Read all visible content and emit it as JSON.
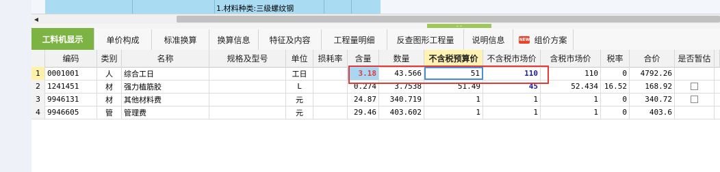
{
  "top_bar": {
    "text": "1.材料种类:三级螺纹钢"
  },
  "tabs": [
    {
      "label": "工料机显示",
      "active": true
    },
    {
      "label": "单价构成"
    },
    {
      "label": "标准换算"
    },
    {
      "label": "换算信息"
    },
    {
      "label": "特征及内容"
    },
    {
      "label": "工程量明细"
    },
    {
      "label": "反查图形工程量"
    },
    {
      "label": "说明信息"
    },
    {
      "label": "组价方案",
      "badge": "NEW"
    }
  ],
  "table": {
    "headers": [
      "编码",
      "类别",
      "名称",
      "规格及型号",
      "单位",
      "损耗率",
      "含量",
      "数量",
      "不含税预算价",
      "不含税市场价",
      "含税市场价",
      "税率",
      "合价",
      "是否暂估"
    ],
    "rows": [
      {
        "num": "1",
        "code": "0001001",
        "type": "人",
        "name": "综合工日",
        "spec": "",
        "unit": "工日",
        "loss": "",
        "content": "3.18",
        "qty": "43.566",
        "budget_price": "51",
        "market_price": "110",
        "tax_market_price": "110",
        "tax_rate": "0",
        "total": "4792.26",
        "checkbox": false
      },
      {
        "num": "2",
        "code": "1241451",
        "type": "材",
        "name": "强力植筋胶",
        "spec": "",
        "unit": "L",
        "loss": "",
        "content": "0.274",
        "qty": "3.7538",
        "budget_price": "51.49",
        "market_price": "45",
        "tax_market_price": "52.434",
        "tax_rate": "16.52",
        "total": "168.92",
        "checkbox": true
      },
      {
        "num": "3",
        "code": "9946131",
        "type": "材",
        "name": "其他材料费",
        "spec": "",
        "unit": "元",
        "loss": "",
        "content": "24.87",
        "qty": "340.719",
        "budget_price": "1",
        "market_price": "1",
        "tax_market_price": "1",
        "tax_rate": "0",
        "total": "340.72",
        "checkbox": true
      },
      {
        "num": "4",
        "code": "9946605",
        "type": "管",
        "name": "管理费",
        "spec": "",
        "unit": "元",
        "loss": "",
        "content": "29.46",
        "qty": "403.602",
        "budget_price": "1",
        "market_price": "1",
        "tax_market_price": "1",
        "tax_rate": "0",
        "total": "403.6",
        "checkbox": false
      }
    ]
  }
}
